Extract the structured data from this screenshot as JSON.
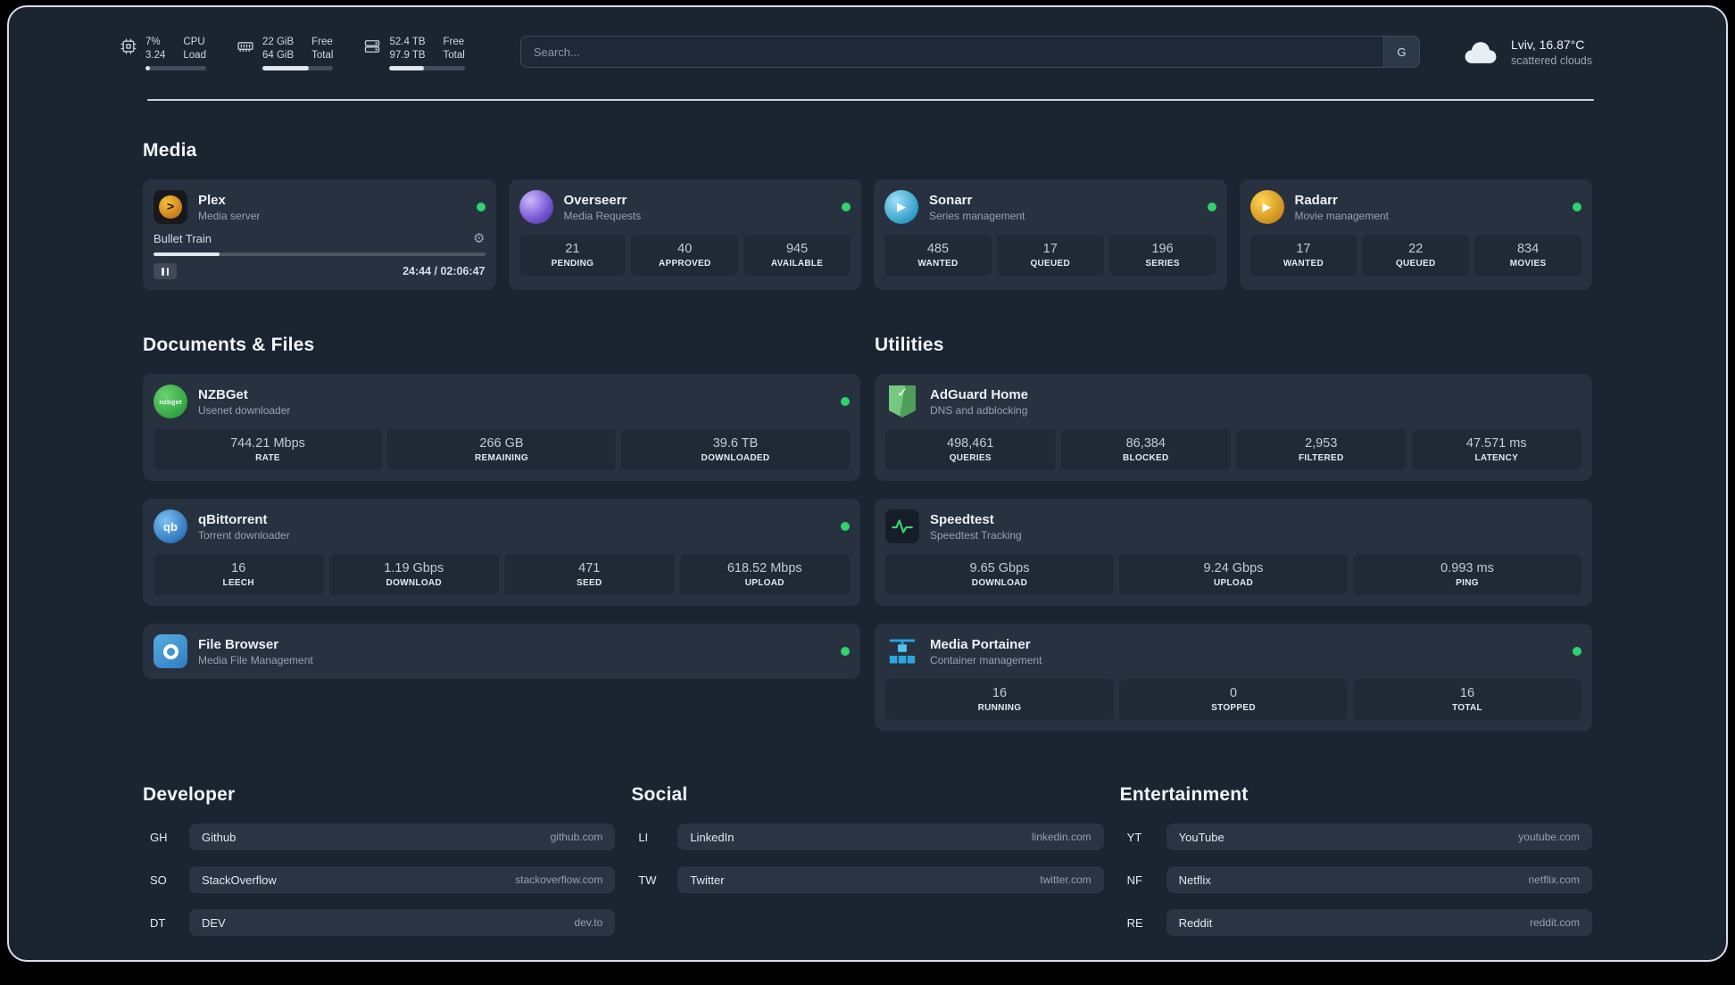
{
  "theme": {
    "background": "#1b2431",
    "card": "#27313f",
    "tile": "#202a37",
    "status_online": "#2fd36f",
    "frame_border": "#d9dfe7"
  },
  "topbar": {
    "resources": [
      {
        "icon": "cpu-icon",
        "value_top": "7%",
        "value_bottom": "3.24",
        "label_top": "CPU",
        "label_bottom": "Load",
        "progress_pct": 7
      },
      {
        "icon": "memory-icon",
        "value_top": "22 GiB",
        "value_bottom": "64 GiB",
        "label_top": "Free",
        "label_bottom": "Total",
        "progress_pct": 66
      },
      {
        "icon": "disk-icon",
        "value_top": "52.4 TB",
        "value_bottom": "97.9 TB",
        "label_top": "Free",
        "label_bottom": "Total",
        "progress_pct": 46
      }
    ],
    "search": {
      "placeholder": "Search...",
      "button_label": "G"
    },
    "weather": {
      "location": "Lviv, 16.87°C",
      "condition": "scattered clouds"
    }
  },
  "media": {
    "title": "Media",
    "cards": [
      {
        "name": "Plex",
        "subtitle": "Media server",
        "online": true,
        "player": {
          "title": "Bullet Train",
          "time": "24:44 / 02:06:47",
          "progress_pct": 20
        }
      },
      {
        "name": "Overseerr",
        "subtitle": "Media Requests",
        "online": true,
        "stats": [
          {
            "value": "21",
            "label": "PENDING"
          },
          {
            "value": "40",
            "label": "APPROVED"
          },
          {
            "value": "945",
            "label": "AVAILABLE"
          }
        ]
      },
      {
        "name": "Sonarr",
        "subtitle": "Series management",
        "online": true,
        "stats": [
          {
            "value": "485",
            "label": "WANTED"
          },
          {
            "value": "17",
            "label": "QUEUED"
          },
          {
            "value": "196",
            "label": "SERIES"
          }
        ]
      },
      {
        "name": "Radarr",
        "subtitle": "Movie management",
        "online": true,
        "stats": [
          {
            "value": "17",
            "label": "WANTED"
          },
          {
            "value": "22",
            "label": "QUEUED"
          },
          {
            "value": "834",
            "label": "MOVIES"
          }
        ]
      }
    ]
  },
  "documents": {
    "title": "Documents & Files",
    "cards": [
      {
        "name": "NZBGet",
        "subtitle": "Usenet downloader",
        "icon_text": "nzbget",
        "online": true,
        "stats": [
          {
            "value": "744.21 Mbps",
            "label": "RATE"
          },
          {
            "value": "266 GB",
            "label": "REMAINING"
          },
          {
            "value": "39.6 TB",
            "label": "DOWNLOADED"
          }
        ]
      },
      {
        "name": "qBittorrent",
        "subtitle": "Torrent downloader",
        "icon_text": "qb",
        "online": true,
        "stats": [
          {
            "value": "16",
            "label": "LEECH"
          },
          {
            "value": "1.19 Gbps",
            "label": "DOWNLOAD"
          },
          {
            "value": "471",
            "label": "SEED"
          },
          {
            "value": "618.52 Mbps",
            "label": "UPLOAD"
          }
        ]
      },
      {
        "name": "File Browser",
        "subtitle": "Media File Management",
        "online": true
      }
    ]
  },
  "utilities": {
    "title": "Utilities",
    "cards": [
      {
        "name": "AdGuard Home",
        "subtitle": "DNS and adblocking",
        "stats": [
          {
            "value": "498,461",
            "label": "QUERIES"
          },
          {
            "value": "86,384",
            "label": "BLOCKED"
          },
          {
            "value": "2,953",
            "label": "FILTERED"
          },
          {
            "value": "47.571 ms",
            "label": "LATENCY"
          }
        ]
      },
      {
        "name": "Speedtest",
        "subtitle": "Speedtest Tracking",
        "stats": [
          {
            "value": "9.65 Gbps",
            "label": "DOWNLOAD"
          },
          {
            "value": "9.24 Gbps",
            "label": "UPLOAD"
          },
          {
            "value": "0.993 ms",
            "label": "PING"
          }
        ]
      },
      {
        "name": "Media Portainer",
        "subtitle": "Container management",
        "online": true,
        "stats": [
          {
            "value": "16",
            "label": "RUNNING"
          },
          {
            "value": "0",
            "label": "STOPPED"
          },
          {
            "value": "16",
            "label": "TOTAL"
          }
        ]
      }
    ]
  },
  "bookmarks": {
    "groups": [
      {
        "title": "Developer",
        "items": [
          {
            "abbr": "GH",
            "name": "Github",
            "domain": "github.com"
          },
          {
            "abbr": "SO",
            "name": "StackOverflow",
            "domain": "stackoverflow.com"
          },
          {
            "abbr": "DT",
            "name": "DEV",
            "domain": "dev.to"
          }
        ]
      },
      {
        "title": "Social",
        "items": [
          {
            "abbr": "LI",
            "name": "LinkedIn",
            "domain": "linkedin.com"
          },
          {
            "abbr": "TW",
            "name": "Twitter",
            "domain": "twitter.com"
          }
        ]
      },
      {
        "title": "Entertainment",
        "items": [
          {
            "abbr": "YT",
            "name": "YouTube",
            "domain": "youtube.com"
          },
          {
            "abbr": "NF",
            "name": "Netflix",
            "domain": "netflix.com"
          },
          {
            "abbr": "RE",
            "name": "Reddit",
            "domain": "reddit.com"
          }
        ]
      }
    ]
  }
}
